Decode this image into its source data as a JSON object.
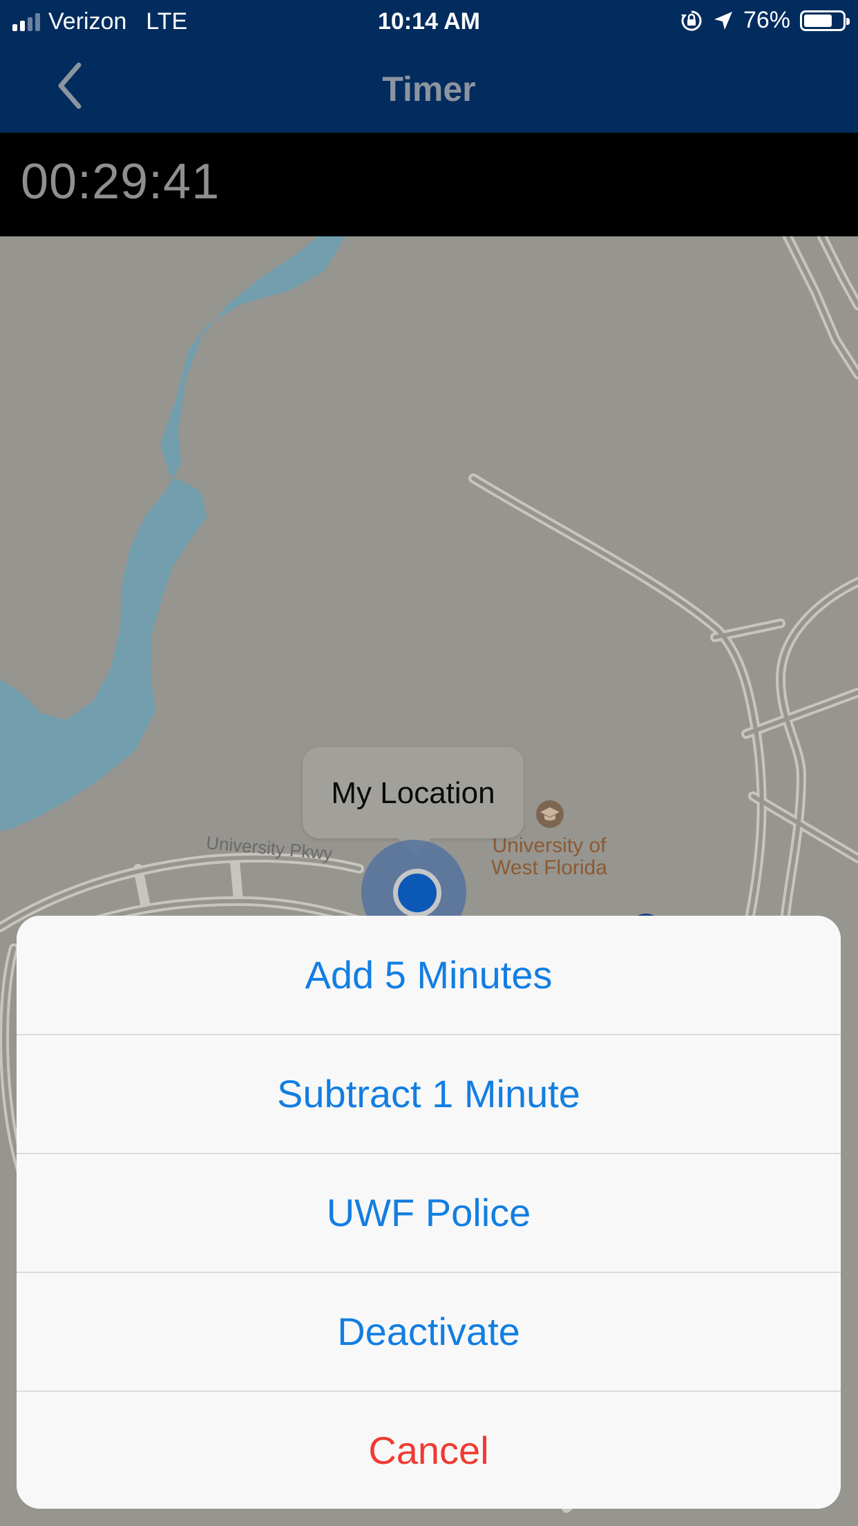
{
  "status_bar": {
    "carrier": "Verizon",
    "network": "LTE",
    "time": "10:14 AM",
    "battery_percent_label": "76%",
    "battery_level": 0.76,
    "icons": [
      "signal-icon",
      "orientation-lock-icon",
      "location-arrow-icon",
      "battery-icon"
    ]
  },
  "nav": {
    "title": "Timer",
    "back_icon": "chevron-left-icon"
  },
  "timer": {
    "value": "00:29:41"
  },
  "map": {
    "callout_text": "My Location",
    "road_label": "University Pkwy",
    "poi_label_line1": "University of",
    "poi_label_line2": "West Florida",
    "poi_icon": "graduation-cap-icon"
  },
  "action_sheet": {
    "items": [
      {
        "label": "Add 5 Minutes"
      },
      {
        "label": "Subtract 1 Minute"
      },
      {
        "label": "UWF Police"
      },
      {
        "label": "Deactivate"
      }
    ],
    "cancel_label": "Cancel"
  },
  "colors": {
    "nav_background": "#022c5e",
    "action_blue": "#127ee2",
    "destructive_red": "#f03a30",
    "map_background": "#97958f",
    "water": "#6f9eb0"
  }
}
